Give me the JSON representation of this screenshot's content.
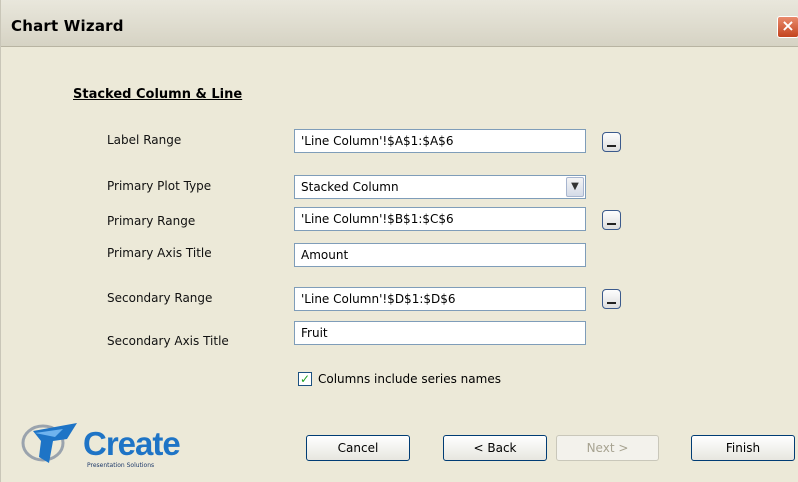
{
  "window": {
    "title": "Chart Wizard",
    "close_label": "×"
  },
  "section": {
    "title": "Stacked Column & Line"
  },
  "form": {
    "label_range": {
      "label": "Label Range",
      "value": "'Line Column'!$A$1:$A$6"
    },
    "primary_plot_type": {
      "label": "Primary Plot Type",
      "value": "Stacked Column"
    },
    "primary_range": {
      "label": "Primary Range",
      "value": "'Line Column'!$B$1:$C$6"
    },
    "primary_axis_title": {
      "label": "Primary Axis Title",
      "value": "Amount"
    },
    "secondary_range": {
      "label": "Secondary Range",
      "value": "'Line Column'!$D$1:$D$6"
    },
    "secondary_axis_title": {
      "label": "Secondary Axis Title",
      "value": "Fruit"
    },
    "series_names": {
      "label": "Columns include series names",
      "checked": true,
      "check_mark": "✓"
    }
  },
  "buttons": {
    "cancel": "Cancel",
    "back": "< Back",
    "next": "Next >",
    "finish": "Finish"
  },
  "logo": {
    "text": "Create",
    "tagline": "Presentation Solutions"
  }
}
